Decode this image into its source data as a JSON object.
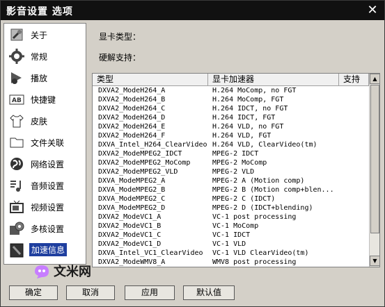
{
  "window": {
    "title": "影音设置 选项"
  },
  "sidebar": {
    "items": [
      {
        "label": "关于",
        "icon": "wrench-icon"
      },
      {
        "label": "常规",
        "icon": "gear-icon"
      },
      {
        "label": "播放",
        "icon": "play-arrow-icon"
      },
      {
        "label": "快捷键",
        "icon": "keyboard-ab-icon"
      },
      {
        "label": "皮肤",
        "icon": "shirt-icon"
      },
      {
        "label": "文件关联",
        "icon": "folder-icon"
      },
      {
        "label": "网络设置",
        "icon": "globe-icon"
      },
      {
        "label": "音频设置",
        "icon": "music-note-icon"
      },
      {
        "label": "视频设置",
        "icon": "tv-icon"
      },
      {
        "label": "多核设置",
        "icon": "cpu-gear-icon"
      },
      {
        "label": "加速信息",
        "icon": "card-icon"
      }
    ],
    "active_index": 10
  },
  "main": {
    "gpu_type_label": "显卡类型：",
    "hw_decode_label": "硬解支持："
  },
  "table": {
    "columns": [
      "类型",
      "显卡加速器",
      "支持"
    ],
    "rows": [
      [
        "DXVA2_ModeH264_A",
        "H.264 MoComp, no FGT"
      ],
      [
        "DXVA2_ModeH264_B",
        "H.264 MoComp, FGT"
      ],
      [
        "DXVA2_ModeH264_C",
        "H.264 IDCT, no FGT"
      ],
      [
        "DXVA2_ModeH264_D",
        "H.264 IDCT, FGT"
      ],
      [
        "DXVA2_ModeH264_E",
        "H.264 VLD, no FGT"
      ],
      [
        "DXVA2_ModeH264_F",
        "H.264 VLD, FGT"
      ],
      [
        "DXVA_Intel_H264_ClearVideo",
        "H.264 VLD, ClearVideo(tm)"
      ],
      [
        "DXVA2_ModeMPEG2_IDCT",
        "MPEG-2 IDCT"
      ],
      [
        "DXVA2_ModeMPEG2_MoComp",
        "MPEG-2 MoComp"
      ],
      [
        "DXVA2_ModeMPEG2_VLD",
        "MPEG-2 VLD"
      ],
      [
        "DXVA_ModeMPEG2_A",
        "MPEG-2 A (Motion comp)"
      ],
      [
        "DXVA_ModeMPEG2_B",
        "MPEG-2 B (Motion comp+blen..."
      ],
      [
        "DXVA_ModeMPEG2_C",
        "MPEG-2 C (IDCT)"
      ],
      [
        "DXVA_ModeMPEG2_D",
        "MPEG-2 D (IDCT+blending)"
      ],
      [
        "DXVA2_ModeVC1_A",
        "VC-1 post processing"
      ],
      [
        "DXVA2_ModeVC1_B",
        "VC-1 MoComp"
      ],
      [
        "DXVA2_ModeVC1_C",
        "VC-1 IDCT"
      ],
      [
        "DXVA2_ModeVC1_D",
        "VC-1 VLD"
      ],
      [
        "DXVA_Intel_VC1_ClearVideo",
        "VC-1 VLD ClearVideo(tm)"
      ],
      [
        "DXVA2_ModeWMV8_A",
        "WMV8 post processing"
      ]
    ]
  },
  "buttons": {
    "ok": "确定",
    "cancel": "取消",
    "apply": "应用",
    "default": "默认值"
  },
  "watermark": {
    "text": "文米网"
  },
  "colors": {
    "titlebar": "#111111",
    "selected": "#1f3f9f",
    "window_bg": "#d4d0c8"
  }
}
